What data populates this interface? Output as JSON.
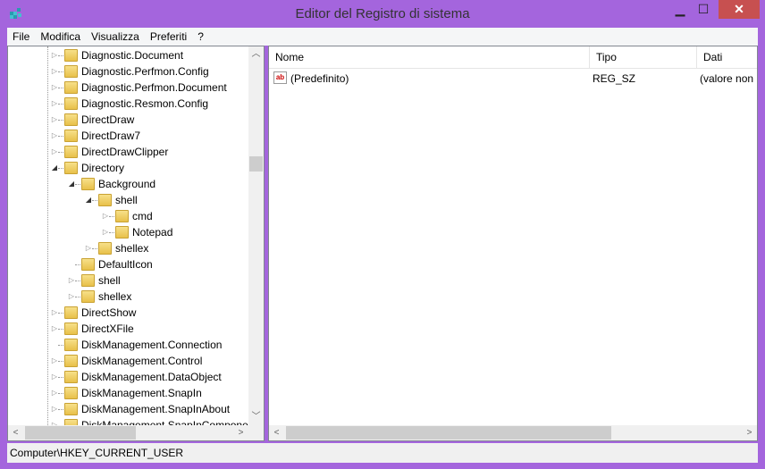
{
  "window": {
    "title": "Editor del Registro di sistema",
    "minimize": "▁",
    "maximize": "☐",
    "close": "✕"
  },
  "menu": [
    "File",
    "Modifica",
    "Visualizza",
    "Preferiti",
    "?"
  ],
  "tree": [
    {
      "label": "Diagnostic.Document",
      "level": 0,
      "state": "collapsed"
    },
    {
      "label": "Diagnostic.Perfmon.Config",
      "level": 0,
      "state": "collapsed"
    },
    {
      "label": "Diagnostic.Perfmon.Document",
      "level": 0,
      "state": "collapsed"
    },
    {
      "label": "Diagnostic.Resmon.Config",
      "level": 0,
      "state": "collapsed"
    },
    {
      "label": "DirectDraw",
      "level": 0,
      "state": "collapsed"
    },
    {
      "label": "DirectDraw7",
      "level": 0,
      "state": "collapsed"
    },
    {
      "label": "DirectDrawClipper",
      "level": 0,
      "state": "collapsed"
    },
    {
      "label": "Directory",
      "level": 0,
      "state": "expanded"
    },
    {
      "label": "Background",
      "level": 1,
      "state": "expanded"
    },
    {
      "label": "shell",
      "level": 2,
      "state": "expanded"
    },
    {
      "label": "cmd",
      "level": 3,
      "state": "collapsed"
    },
    {
      "label": "Notepad",
      "level": 3,
      "state": "collapsed"
    },
    {
      "label": "shellex",
      "level": 2,
      "state": "collapsed"
    },
    {
      "label": "DefaultIcon",
      "level": 1,
      "state": "leaf"
    },
    {
      "label": "shell",
      "level": 1,
      "state": "collapsed"
    },
    {
      "label": "shellex",
      "level": 1,
      "state": "collapsed"
    },
    {
      "label": "DirectShow",
      "level": 0,
      "state": "collapsed"
    },
    {
      "label": "DirectXFile",
      "level": 0,
      "state": "collapsed"
    },
    {
      "label": "DiskManagement.Connection",
      "level": 0,
      "state": "leaf"
    },
    {
      "label": "DiskManagement.Control",
      "level": 0,
      "state": "collapsed"
    },
    {
      "label": "DiskManagement.DataObject",
      "level": 0,
      "state": "collapsed"
    },
    {
      "label": "DiskManagement.SnapIn",
      "level": 0,
      "state": "collapsed"
    },
    {
      "label": "DiskManagement.SnapInAbout",
      "level": 0,
      "state": "collapsed"
    },
    {
      "label": "DiskManagement.SnapInCompone",
      "level": 0,
      "state": "collapsed"
    }
  ],
  "list": {
    "columns": [
      "Nome",
      "Tipo",
      "Dati"
    ],
    "rows": [
      {
        "name": "(Predefinito)",
        "type": "REG_SZ",
        "data": "(valore non",
        "icon": "string-value-icon"
      }
    ]
  },
  "status": "Computer\\HKEY_CURRENT_USER",
  "colors": {
    "frame": "#a465dd",
    "close": "#c75050"
  }
}
